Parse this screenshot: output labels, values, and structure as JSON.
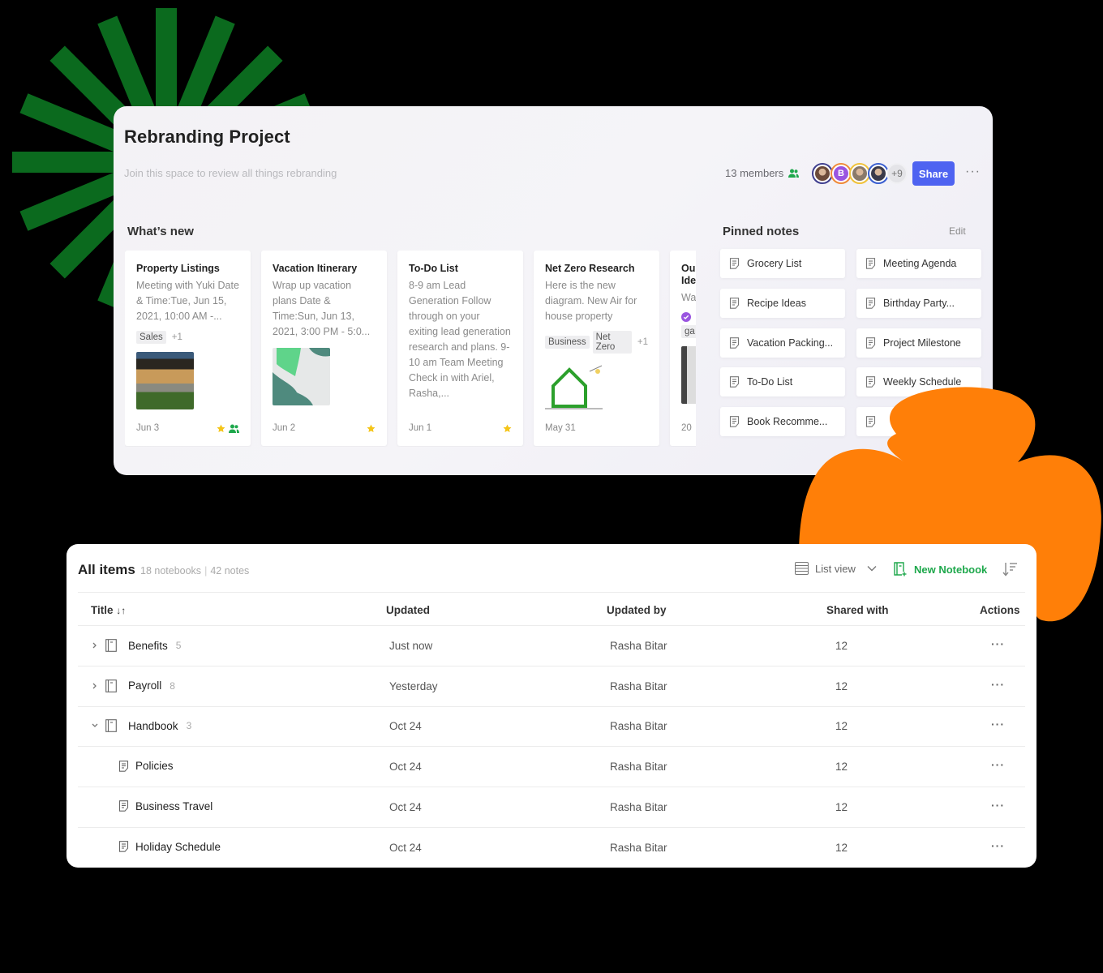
{
  "space": {
    "title": "Rebranding Project",
    "description": "Join this space to review all things rebranding",
    "members_label": "13 members",
    "avatars": [
      {
        "kind": "photo",
        "ring": "#3f3f8f"
      },
      {
        "kind": "initial",
        "initial": "B",
        "ring": "#f08b3a",
        "fill": "#9a55e0"
      },
      {
        "kind": "photo",
        "ring": "#f0c23a"
      },
      {
        "kind": "photo",
        "ring": "#3a5fd0"
      }
    ],
    "avatars_more": "+9",
    "share_label": "Share",
    "more_label": "···",
    "whats_new_label": "What’s new",
    "pinned_label": "Pinned notes",
    "edit_label": "Edit",
    "cards": [
      {
        "title": "Property Listings",
        "body": "Meeting with Yuki Date & Time:Tue, Jun 15, 2021, 10:00 AM -...",
        "tags": [
          "Sales"
        ],
        "tags_more": "+1",
        "thumb": "house-photo",
        "date": "Jun 3",
        "starred": true,
        "shared": true
      },
      {
        "title": "Vacation Itinerary",
        "body": "Wrap up vacation plans Date & Time:Sun, Jun 13, 2021, 3:00 PM - 5:0...",
        "tags": [],
        "tags_more": "",
        "thumb": "map",
        "date": "Jun 2",
        "starred": true,
        "shared": false
      },
      {
        "title": "To-Do List",
        "body": "8-9 am Lead Generation Follow through on your exiting lead generation research and plans. 9-10 am Team Meeting Check in with Ariel, Rasha,...",
        "tags": [],
        "tags_more": "",
        "thumb": "",
        "date": "Jun 1",
        "starred": true,
        "shared": false
      },
      {
        "title": "Net Zero Research",
        "body": "Here is the new diagram. New Air for house property",
        "tags": [
          "Business",
          "Net Zero"
        ],
        "tags_more": "+1",
        "thumb": "house-diagram",
        "date": "May 31",
        "starred": false,
        "shared": false
      },
      {
        "title": "Ou Ide",
        "body": "Wa",
        "tags": [
          "ga"
        ],
        "tags_more": "",
        "thumb": "interior-photo",
        "date": "20",
        "starred": false,
        "shared": false
      }
    ],
    "pinned": [
      "Grocery List",
      "Meeting Agenda",
      "Recipe Ideas",
      "Birthday Party...",
      "Vacation Packing...",
      "Project Milestone",
      "To-Do List",
      "Weekly Schedule",
      "Book Recomme...",
      ""
    ]
  },
  "items": {
    "title": "All items",
    "notebooks_count": "18 notebooks",
    "notes_count": "42 notes",
    "list_view_label": "List view",
    "new_notebook_label": "New Notebook",
    "columns": [
      "Title",
      "Updated",
      "Updated by",
      "Shared with",
      "Actions"
    ],
    "title_sort_icon": "↓↑",
    "rows": [
      {
        "type": "notebook",
        "expanded": false,
        "name": "Benefits",
        "count": "5",
        "updated": "Just now",
        "updated_by": "Rasha Bitar",
        "shared_with": "12"
      },
      {
        "type": "notebook",
        "expanded": false,
        "name": "Payroll",
        "count": "8",
        "updated": "Yesterday",
        "updated_by": "Rasha Bitar",
        "shared_with": "12"
      },
      {
        "type": "notebook",
        "expanded": true,
        "name": "Handbook",
        "count": "3",
        "updated": "Oct 24",
        "updated_by": "Rasha Bitar",
        "shared_with": "12"
      },
      {
        "type": "note",
        "name": "Policies",
        "count": "",
        "updated": "Oct 24",
        "updated_by": "Rasha Bitar",
        "shared_with": "12"
      },
      {
        "type": "note",
        "name": "Business Travel",
        "count": "",
        "updated": "Oct 24",
        "updated_by": "Rasha Bitar",
        "shared_with": "12"
      },
      {
        "type": "note",
        "name": "Holiday Schedule",
        "count": "",
        "updated": "Oct 24",
        "updated_by": "Rasha Bitar",
        "shared_with": "12"
      }
    ],
    "row_action_label": "···"
  },
  "colors": {
    "burst": "#0b6a1e",
    "blob": "#ff7f08",
    "share": "#4e63f1",
    "new_notebook": "#1ea84c",
    "star": "#f5c518",
    "shared_icon": "#1ea84c"
  }
}
